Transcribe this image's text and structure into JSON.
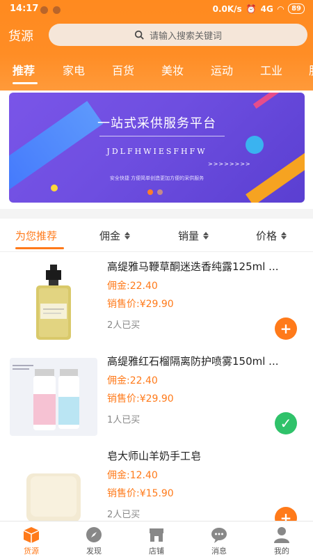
{
  "status": {
    "time": "14:17",
    "network": "0.0K/s",
    "signal": "4G",
    "battery": "89"
  },
  "topbar": {
    "brand": "货源",
    "search_placeholder": "请输入搜索关键词"
  },
  "tabs": [
    "推荐",
    "家电",
    "百货",
    "美妆",
    "运动",
    "工业",
    "服"
  ],
  "banner": {
    "title": "一站式采供服务平台",
    "subtitle": "JDLFHWIESFHFW",
    "arrows": ">>>>>>>>",
    "tagline": "安全快捷 方便简单创造更加方便的采供服务"
  },
  "sort": {
    "recommend": "为您推荐",
    "commission": "佣金",
    "sales": "销量",
    "price": "价格"
  },
  "products": [
    {
      "name": "高缇雅马鞭草酮迷迭香纯露125ml ...",
      "commission": "佣金:22.40",
      "price": "销售价:¥29.90",
      "sold": "2人已买",
      "action": "+"
    },
    {
      "name": "高缇雅红石榴隔离防护喷雾150ml ...",
      "commission": "佣金:22.40",
      "price": "销售价:¥29.90",
      "sold": "1人已买",
      "action": "✓"
    },
    {
      "name": "皂大师山羊奶手工皂",
      "commission": "佣金:12.40",
      "price": "销售价:¥15.90",
      "sold": "2人已买",
      "action": "+"
    }
  ],
  "nav": {
    "home": "货源",
    "discover": "发现",
    "shop": "店铺",
    "messages": "消息",
    "me": "我的"
  },
  "colors": {
    "accent": "#ff7a1a",
    "success": "#2fc26a",
    "banner": "#6e4ee0"
  }
}
